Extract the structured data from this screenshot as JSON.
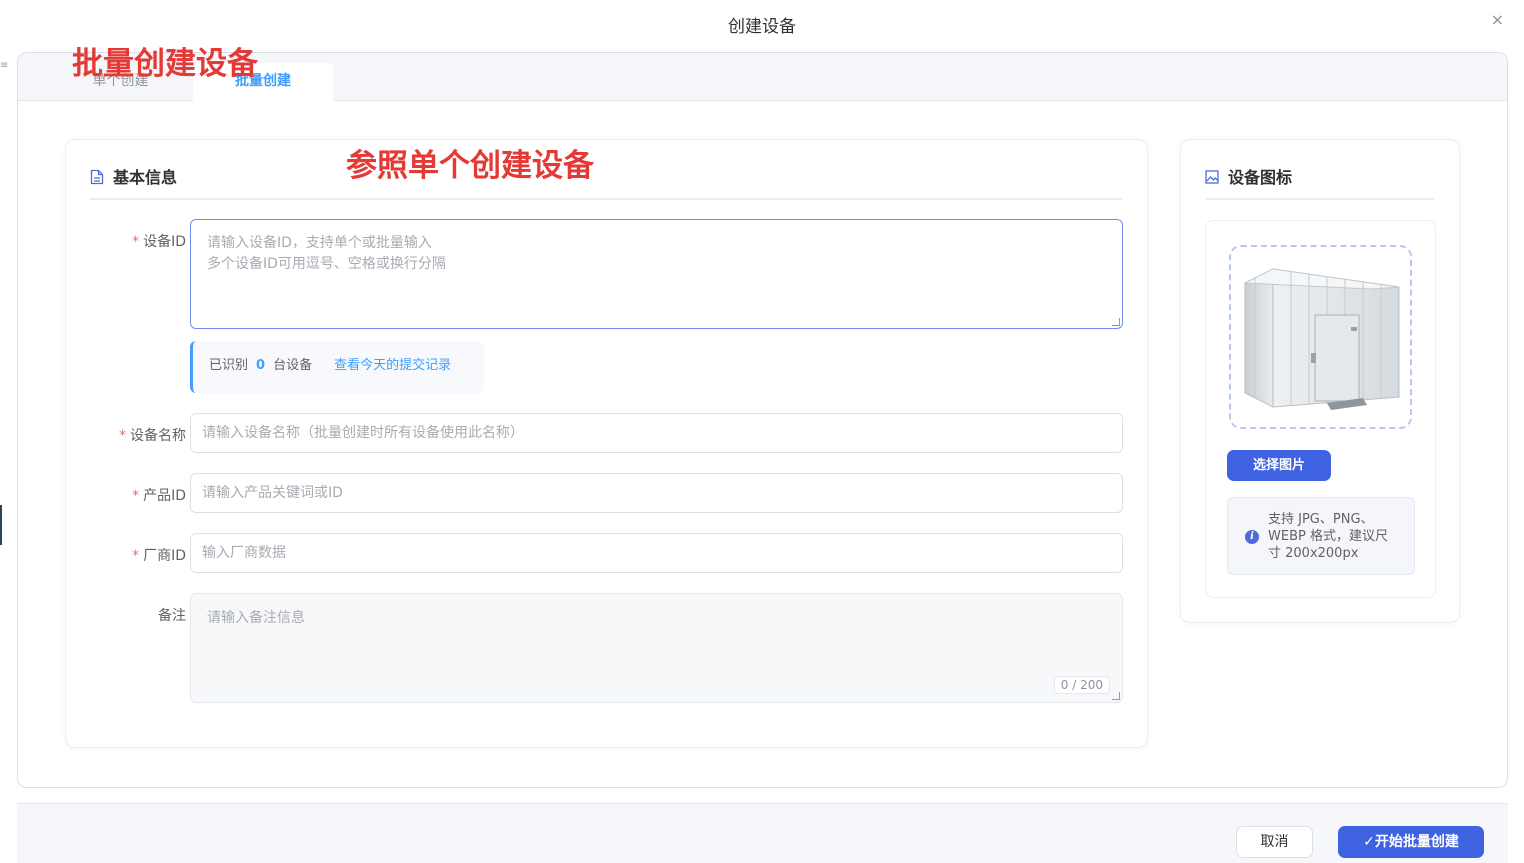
{
  "dialog": {
    "title": "创建设备",
    "close_label": "×",
    "edge_mark": "≡"
  },
  "annotations": {
    "batch_title": "批量创建设备",
    "reference_note": "参照单个创建设备"
  },
  "tabs": [
    {
      "label": "单个创建",
      "active": false
    },
    {
      "label": "批量创建",
      "active": true
    }
  ],
  "basic_info": {
    "title": "基本信息",
    "icon": "document-icon",
    "device_id": {
      "label": "设备ID",
      "required": true,
      "placeholder_line1": "请输入设备ID，支持单个或批量输入",
      "placeholder_line2": "多个设备ID可用逗号、空格或换行分隔"
    },
    "recognized": {
      "prefix": "已识别",
      "count": "0",
      "suffix": "台设备",
      "link": "查看今天的提交记录"
    },
    "device_name": {
      "label": "设备名称",
      "required": true,
      "placeholder": "请输入设备名称（批量创建时所有设备使用此名称）"
    },
    "product_id": {
      "label": "产品ID",
      "required": true,
      "placeholder": "请输入产品关键词或ID"
    },
    "vendor_id": {
      "label": "厂商ID",
      "required": true,
      "placeholder": "输入厂商数据"
    },
    "remark": {
      "label": "备注",
      "required": false,
      "placeholder": "请输入备注信息",
      "counter": "0 / 200"
    }
  },
  "device_icon": {
    "title": "设备图标",
    "icon": "image-icon",
    "select_button": "选择图片",
    "hint": "支持 JPG、PNG、WEBP 格式，建议尺寸 200x200px"
  },
  "footer": {
    "cancel": "取消",
    "submit": "✓开始批量创建"
  },
  "colors": {
    "primary": "#3f63e0",
    "link": "#409eff",
    "required": "#f56c6c",
    "annotation": "#e53935"
  }
}
